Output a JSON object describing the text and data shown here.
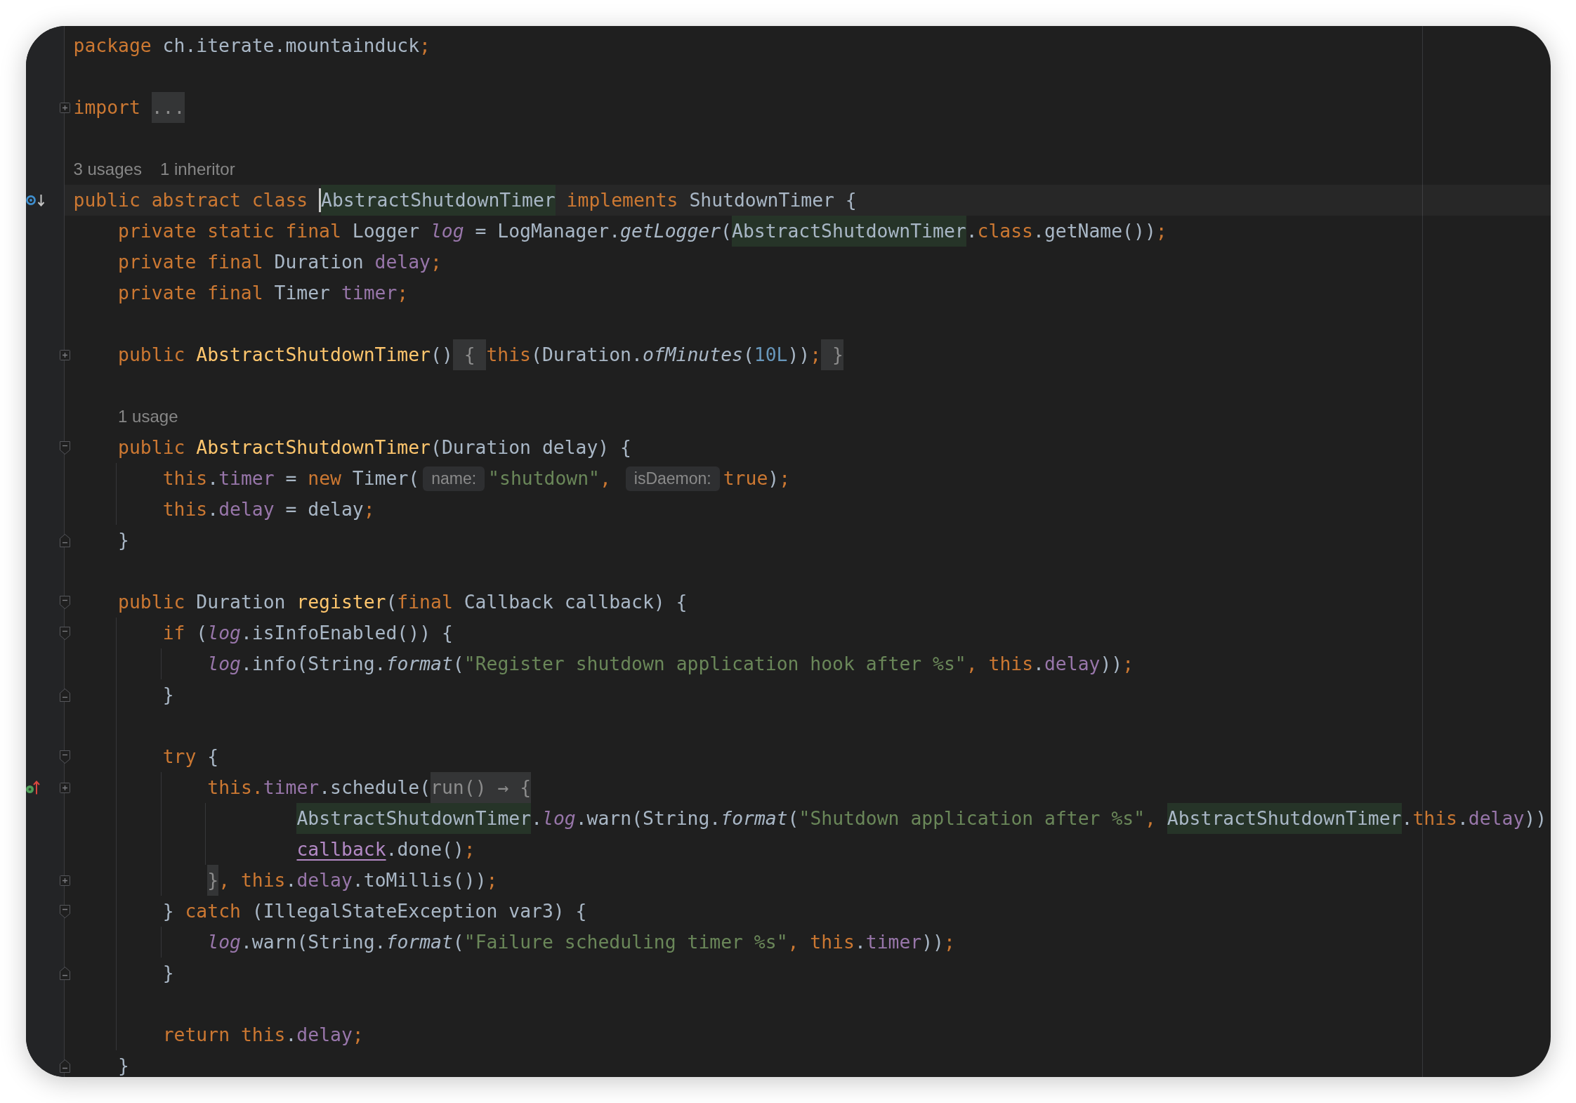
{
  "editor": {
    "lines": [
      {
        "kind": "code",
        "tokens": [
          {
            "text": "package",
            "kind": "keyword"
          },
          {
            "text": " ch.iterate.mountainduck",
            "kind": "plain"
          },
          {
            "text": ";",
            "kind": "keyword"
          }
        ]
      },
      {
        "kind": "blank"
      },
      {
        "kind": "code",
        "fold": {
          "kind": "collapsed"
        },
        "tokens": [
          {
            "text": "import ",
            "kind": "keyword"
          },
          {
            "text": "...",
            "kind": "fold"
          }
        ]
      },
      {
        "kind": "blank"
      },
      {
        "kind": "lens",
        "items": [
          "3 usages",
          "1 inheritor"
        ]
      },
      {
        "kind": "code",
        "gutter": {
          "kind": "subclassed"
        },
        "tokens": [
          {
            "text": "public abstract class ",
            "kind": "keyword"
          },
          {
            "kind": "caret"
          },
          {
            "text": "AbstractShutdownTimer",
            "kind": "usage"
          },
          {
            "text": " implements",
            "kind": "keyword"
          },
          {
            "text": " ShutdownTimer {",
            "kind": "plain"
          }
        ],
        "children": [
          {
            "kind": "code",
            "tokens": [
              {
                "text": "private static final",
                "kind": "keyword"
              },
              {
                "text": " Logger ",
                "kind": "plain"
              },
              {
                "text": "log",
                "kind": "static"
              },
              {
                "text": " = LogManager.",
                "kind": "plain"
              },
              {
                "text": "getLogger",
                "kind": "call"
              },
              {
                "text": "(",
                "kind": "plain"
              },
              {
                "text": "AbstractShutdownTimer",
                "kind": "usage"
              },
              {
                "text": ".",
                "kind": "plain"
              },
              {
                "text": "class",
                "kind": "keyword"
              },
              {
                "text": ".getName())",
                "kind": "plain"
              },
              {
                "text": ";",
                "kind": "keyword"
              }
            ]
          },
          {
            "kind": "code",
            "tokens": [
              {
                "text": "private final",
                "kind": "keyword"
              },
              {
                "text": " Duration ",
                "kind": "plain"
              },
              {
                "text": "delay",
                "kind": "field"
              },
              {
                "text": ";",
                "kind": "keyword"
              }
            ]
          },
          {
            "kind": "code",
            "tokens": [
              {
                "text": "private final",
                "kind": "keyword"
              },
              {
                "text": " Timer ",
                "kind": "plain"
              },
              {
                "text": "timer",
                "kind": "field"
              },
              {
                "text": ";",
                "kind": "keyword"
              }
            ]
          },
          {
            "kind": "blank"
          },
          {
            "kind": "code",
            "fold": {
              "kind": "collapsed"
            },
            "tokens": [
              {
                "text": "public ",
                "kind": "keyword"
              },
              {
                "text": "AbstractShutdownTimer",
                "kind": "declaration"
              },
              {
                "text": "()",
                "kind": "plain"
              },
              {
                "text": " { ",
                "kind": "fold"
              },
              {
                "text": "this",
                "kind": "keyword"
              },
              {
                "text": "(Duration.",
                "kind": "plain"
              },
              {
                "text": "ofMinutes",
                "kind": "call"
              },
              {
                "text": "(",
                "kind": "plain"
              },
              {
                "text": "10L",
                "kind": "number"
              },
              {
                "text": "))",
                "kind": "plain"
              },
              {
                "text": ";",
                "kind": "keyword"
              },
              {
                "text": " }",
                "kind": "fold"
              }
            ]
          },
          {
            "kind": "blank"
          },
          {
            "kind": "lens",
            "items": [
              "1 usage"
            ]
          },
          {
            "kind": "code",
            "fold": {
              "kind": "start"
            },
            "tokens": [
              {
                "text": "public ",
                "kind": "keyword"
              },
              {
                "text": "AbstractShutdownTimer",
                "kind": "declaration"
              },
              {
                "text": "(Duration delay) {",
                "kind": "plain"
              }
            ],
            "children": [
              {
                "kind": "code",
                "tokens": [
                  {
                    "text": "this",
                    "kind": "keyword"
                  },
                  {
                    "text": ".",
                    "kind": "plain"
                  },
                  {
                    "text": "timer",
                    "kind": "field"
                  },
                  {
                    "text": " = ",
                    "kind": "plain"
                  },
                  {
                    "text": "new",
                    "kind": "keyword"
                  },
                  {
                    "text": " Timer(",
                    "kind": "plain"
                  },
                  {
                    "text": "name:",
                    "kind": "hint"
                  },
                  {
                    "text": "\"shutdown\"",
                    "kind": "string"
                  },
                  {
                    "text": ", ",
                    "kind": "keyword"
                  },
                  {
                    "text": "isDaemon:",
                    "kind": "hint"
                  },
                  {
                    "text": "true",
                    "kind": "keyword"
                  },
                  {
                    "text": ")",
                    "kind": "plain"
                  },
                  {
                    "text": ";",
                    "kind": "keyword"
                  }
                ]
              },
              {
                "kind": "code",
                "tokens": [
                  {
                    "text": "this",
                    "kind": "keyword"
                  },
                  {
                    "text": ".",
                    "kind": "plain"
                  },
                  {
                    "text": "delay",
                    "kind": "field"
                  },
                  {
                    "text": " = delay",
                    "kind": "plain"
                  },
                  {
                    "text": ";",
                    "kind": "keyword"
                  }
                ]
              }
            ]
          },
          {
            "kind": "code",
            "fold": {
              "kind": "end"
            },
            "tokens": [
              {
                "text": "}",
                "kind": "plain"
              }
            ]
          },
          {
            "kind": "blank"
          },
          {
            "kind": "code",
            "fold": {
              "kind": "start"
            },
            "tokens": [
              {
                "text": "public",
                "kind": "keyword"
              },
              {
                "text": " Duration ",
                "kind": "plain"
              },
              {
                "text": "register",
                "kind": "declaration"
              },
              {
                "text": "(",
                "kind": "plain"
              },
              {
                "text": "final",
                "kind": "keyword"
              },
              {
                "text": " Callback callback) {",
                "kind": "plain"
              }
            ],
            "children": [
              {
                "kind": "code",
                "fold": {
                  "kind": "start"
                },
                "tokens": [
                  {
                    "text": "if",
                    "kind": "keyword"
                  },
                  {
                    "text": " (",
                    "kind": "plain"
                  },
                  {
                    "text": "log",
                    "kind": "static"
                  },
                  {
                    "text": ".isInfoEnabled()) {",
                    "kind": "plain"
                  }
                ],
                "children": [
                  {
                    "kind": "code",
                    "tokens": [
                      {
                        "text": "log",
                        "kind": "static"
                      },
                      {
                        "text": ".info(String.",
                        "kind": "plain"
                      },
                      {
                        "text": "format",
                        "kind": "call"
                      },
                      {
                        "text": "(",
                        "kind": "plain"
                      },
                      {
                        "text": "\"Register shutdown application hook after %s\"",
                        "kind": "string"
                      },
                      {
                        "text": ", this",
                        "kind": "keyword"
                      },
                      {
                        "text": ".",
                        "kind": "plain"
                      },
                      {
                        "text": "delay",
                        "kind": "field"
                      },
                      {
                        "text": "))",
                        "kind": "plain"
                      },
                      {
                        "text": ";",
                        "kind": "keyword"
                      }
                    ]
                  }
                ]
              },
              {
                "kind": "code",
                "fold": {
                  "kind": "end"
                },
                "tokens": [
                  {
                    "text": "}",
                    "kind": "plain"
                  }
                ]
              },
              {
                "kind": "blank"
              },
              {
                "kind": "code",
                "fold": {
                  "kind": "start"
                },
                "tokens": [
                  {
                    "text": "try",
                    "kind": "keyword"
                  },
                  {
                    "text": " {",
                    "kind": "plain"
                  }
                ],
                "children": [
                  {
                    "kind": "code",
                    "fold": {
                      "kind": "collapsed"
                    },
                    "gutter": {
                      "kind": "overriding"
                    },
                    "tokens": [
                      {
                        "text": "this.",
                        "kind": "keyword"
                      },
                      {
                        "text": "timer",
                        "kind": "field"
                      },
                      {
                        "text": ".schedule(",
                        "kind": "plain"
                      },
                      {
                        "text": "run() → {",
                        "kind": "fold"
                      }
                    ],
                    "children": [
                      {
                        "kind": "block",
                        "children": [
                          {
                            "kind": "code",
                            "tokens": [
                              {
                                "text": "AbstractShutdownTimer",
                                "kind": "usage"
                              },
                              {
                                "text": ".",
                                "kind": "plain"
                              },
                              {
                                "text": "log",
                                "kind": "static"
                              },
                              {
                                "text": ".warn(String.",
                                "kind": "plain"
                              },
                              {
                                "text": "format",
                                "kind": "call"
                              },
                              {
                                "text": "(",
                                "kind": "plain"
                              },
                              {
                                "text": "\"Shutdown application after %s\"",
                                "kind": "string"
                              },
                              {
                                "text": ", ",
                                "kind": "keyword"
                              },
                              {
                                "text": "AbstractShutdownTimer",
                                "kind": "usage"
                              },
                              {
                                "text": ".",
                                "kind": "plain"
                              },
                              {
                                "text": "this",
                                "kind": "keyword"
                              },
                              {
                                "text": ".",
                                "kind": "plain"
                              },
                              {
                                "text": "delay",
                                "kind": "field"
                              },
                              {
                                "text": "))",
                                "kind": "plain"
                              }
                            ]
                          },
                          {
                            "kind": "code",
                            "tokens": [
                              {
                                "text": "callback",
                                "kind": "captured"
                              },
                              {
                                "text": ".done()",
                                "kind": "plain"
                              },
                              {
                                "text": ";",
                                "kind": "keyword"
                              }
                            ]
                          }
                        ]
                      }
                    ]
                  },
                  {
                    "kind": "code",
                    "fold": {
                      "kind": "collapsed"
                    },
                    "tokens": [
                      {
                        "text": "}",
                        "kind": "fold"
                      },
                      {
                        "text": ", this",
                        "kind": "keyword"
                      },
                      {
                        "text": ".",
                        "kind": "plain"
                      },
                      {
                        "text": "delay",
                        "kind": "field"
                      },
                      {
                        "text": ".toMillis())",
                        "kind": "plain"
                      },
                      {
                        "text": ";",
                        "kind": "keyword"
                      }
                    ]
                  }
                ]
              },
              {
                "kind": "code",
                "fold": {
                  "kind": "start"
                },
                "tokens": [
                  {
                    "text": "} ",
                    "kind": "plain"
                  },
                  {
                    "text": "catch",
                    "kind": "keyword"
                  },
                  {
                    "text": " (IllegalStateException var3) {",
                    "kind": "plain"
                  }
                ],
                "children": [
                  {
                    "kind": "code",
                    "tokens": [
                      {
                        "text": "log",
                        "kind": "static"
                      },
                      {
                        "text": ".warn(String.",
                        "kind": "plain"
                      },
                      {
                        "text": "format",
                        "kind": "call"
                      },
                      {
                        "text": "(",
                        "kind": "plain"
                      },
                      {
                        "text": "\"Failure scheduling timer %s\"",
                        "kind": "string"
                      },
                      {
                        "text": ", this",
                        "kind": "keyword"
                      },
                      {
                        "text": ".",
                        "kind": "plain"
                      },
                      {
                        "text": "timer",
                        "kind": "field"
                      },
                      {
                        "text": "))",
                        "kind": "plain"
                      },
                      {
                        "text": ";",
                        "kind": "keyword"
                      }
                    ]
                  }
                ]
              },
              {
                "kind": "code",
                "fold": {
                  "kind": "end"
                },
                "tokens": [
                  {
                    "text": "}",
                    "kind": "plain"
                  }
                ]
              },
              {
                "kind": "blank"
              },
              {
                "kind": "code",
                "tokens": [
                  {
                    "text": "return this",
                    "kind": "keyword"
                  },
                  {
                    "text": ".",
                    "kind": "plain"
                  },
                  {
                    "text": "delay",
                    "kind": "field"
                  },
                  {
                    "text": ";",
                    "kind": "keyword"
                  }
                ]
              }
            ]
          },
          {
            "kind": "code",
            "fold": {
              "kind": "end"
            },
            "tokens": [
              {
                "text": "}",
                "kind": "plain"
              }
            ]
          }
        ]
      }
    ]
  }
}
